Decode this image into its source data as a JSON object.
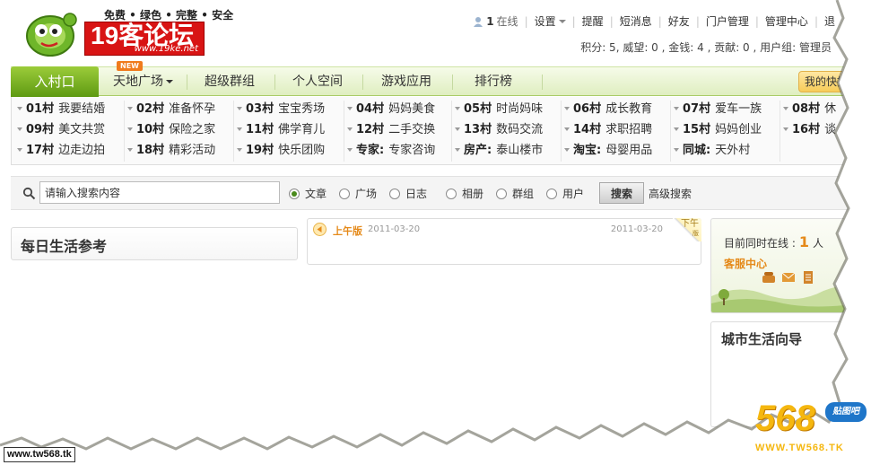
{
  "logo": {
    "slogan": "免费 • 绿色 • 完整 • 安全",
    "name": "19客论坛",
    "url": "www.19ke.net"
  },
  "topnav": {
    "online_count": "1",
    "online_label": "在线",
    "links": [
      "设置",
      "提醒",
      "短消息",
      "好友",
      "门户管理",
      "管理中心",
      "退"
    ]
  },
  "stats": "积分: 5, 威望: 0 , 金钱: 4 , 贡献: 0 , 用户组: 管理员",
  "mainnav": {
    "home": "入村口",
    "badge": "NEW",
    "items": [
      "天地广场",
      "超级群组",
      "个人空间",
      "游戏应用",
      "排行榜"
    ],
    "quick": "我的快捷"
  },
  "villages": [
    [
      {
        "code": "01村",
        "name": "我要结婚"
      },
      {
        "code": "09村",
        "name": "美文共赏"
      },
      {
        "code": "17村",
        "name": "边走边拍"
      }
    ],
    [
      {
        "code": "02村",
        "name": "准备怀孕"
      },
      {
        "code": "10村",
        "name": "保险之家"
      },
      {
        "code": "18村",
        "name": "精彩活动"
      }
    ],
    [
      {
        "code": "03村",
        "name": "宝宝秀场"
      },
      {
        "code": "11村",
        "name": "佛学育儿"
      },
      {
        "code": "19村",
        "name": "快乐团购"
      }
    ],
    [
      {
        "code": "04村",
        "name": "妈妈美食"
      },
      {
        "code": "12村",
        "name": "二手交换"
      },
      {
        "code": "专家:",
        "name": "专家咨询"
      }
    ],
    [
      {
        "code": "05村",
        "name": "时尚妈味"
      },
      {
        "code": "13村",
        "name": "数码交流"
      },
      {
        "code": "房产:",
        "name": "泰山楼市"
      }
    ],
    [
      {
        "code": "06村",
        "name": "成长教育"
      },
      {
        "code": "14村",
        "name": "求职招聘"
      },
      {
        "code": "淘宝:",
        "name": "母婴用品"
      }
    ],
    [
      {
        "code": "07村",
        "name": "爱车一族"
      },
      {
        "code": "15村",
        "name": "妈妈创业"
      },
      {
        "code": "同城:",
        "name": "天外村"
      }
    ],
    [
      {
        "code": "08村",
        "name": "休"
      },
      {
        "code": "16村",
        "name": "谈"
      }
    ]
  ],
  "search": {
    "placeholder": "请输入搜索内容",
    "options": [
      "文章",
      "广场",
      "日志",
      "相册",
      "群组",
      "用户"
    ],
    "selected": "文章",
    "button": "搜索",
    "advanced": "高级搜索"
  },
  "daily": {
    "title": "每日生活参考"
  },
  "edition": {
    "label": "上午版",
    "date": "2011-03-20",
    "date_right": "2011-03-20",
    "next": "下午",
    "next_small": "版"
  },
  "online_panel": {
    "prefix": "目前同时在线 :",
    "count": "1",
    "suffix": "人",
    "service": "客服中心"
  },
  "city_guide": {
    "title": "城市生活向导"
  },
  "watermark": {
    "left": "www.tw568.tk",
    "logo": "568",
    "bubble": "贴图吧",
    "url": "WWW.TW568.TK"
  },
  "colors": {
    "accent_green": "#5e9a12",
    "nav_bg": "#dfeec0",
    "logo_red": "#d81414",
    "highlight_orange": "#e58a1a",
    "watermark_gold": "#f5b70f"
  }
}
